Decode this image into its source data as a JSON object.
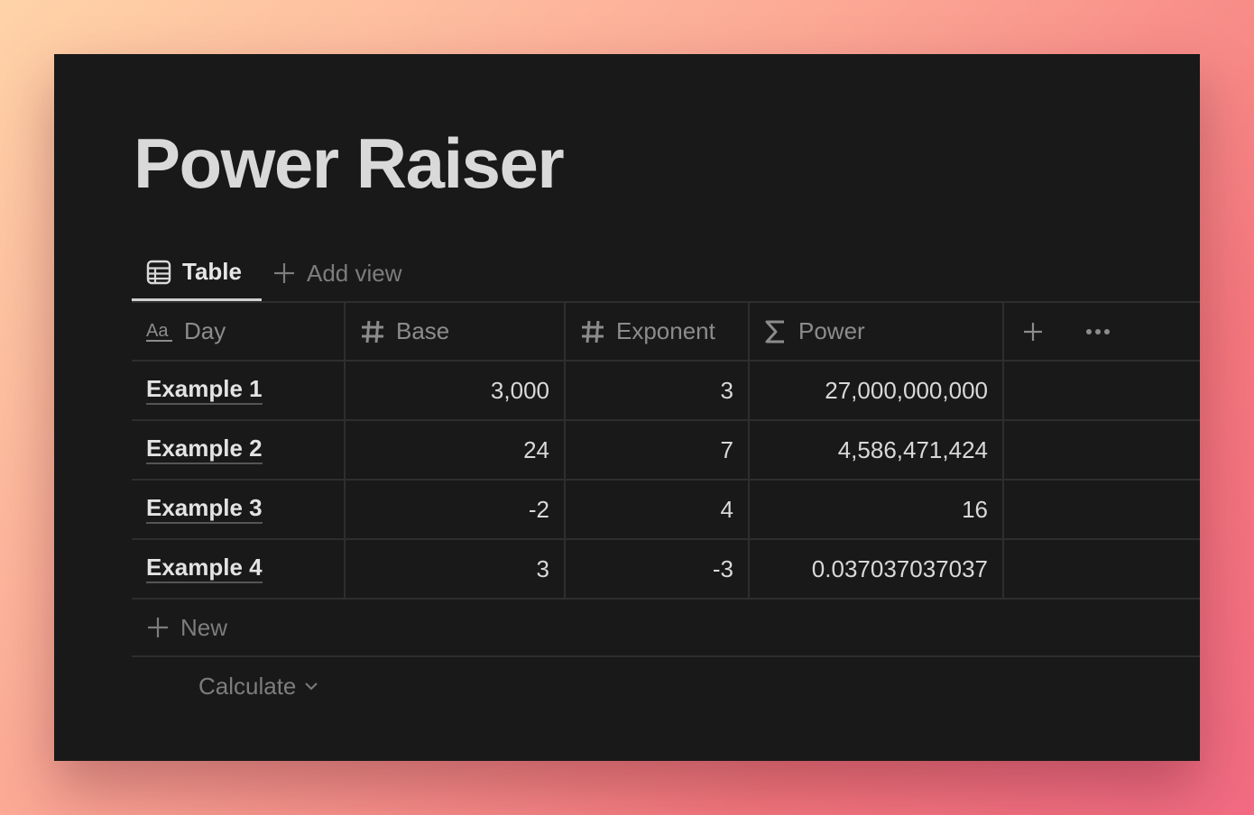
{
  "page": {
    "title": "Power Raiser"
  },
  "views": {
    "active_tab": "Table",
    "add_view_label": "Add view"
  },
  "table": {
    "columns": [
      {
        "label": "Day",
        "icon": "text-property-icon"
      },
      {
        "label": "Base",
        "icon": "number-property-icon"
      },
      {
        "label": "Exponent",
        "icon": "number-property-icon"
      },
      {
        "label": "Power",
        "icon": "formula-sigma-icon"
      }
    ],
    "rows": [
      {
        "day": "Example 1",
        "base": "3,000",
        "exponent": "3",
        "power": "27,000,000,000"
      },
      {
        "day": "Example 2",
        "base": "24",
        "exponent": "7",
        "power": "4,586,471,424"
      },
      {
        "day": "Example 3",
        "base": "-2",
        "exponent": "4",
        "power": "16"
      },
      {
        "day": "Example 4",
        "base": "3",
        "exponent": "-3",
        "power": "0.037037037037"
      }
    ],
    "new_label": "New",
    "calculate_label": "Calculate"
  },
  "colors": {
    "page_bg": "#191919",
    "text": "#d9d9d9",
    "muted": "#7d7d7d",
    "grid": "#2e2e2e"
  }
}
